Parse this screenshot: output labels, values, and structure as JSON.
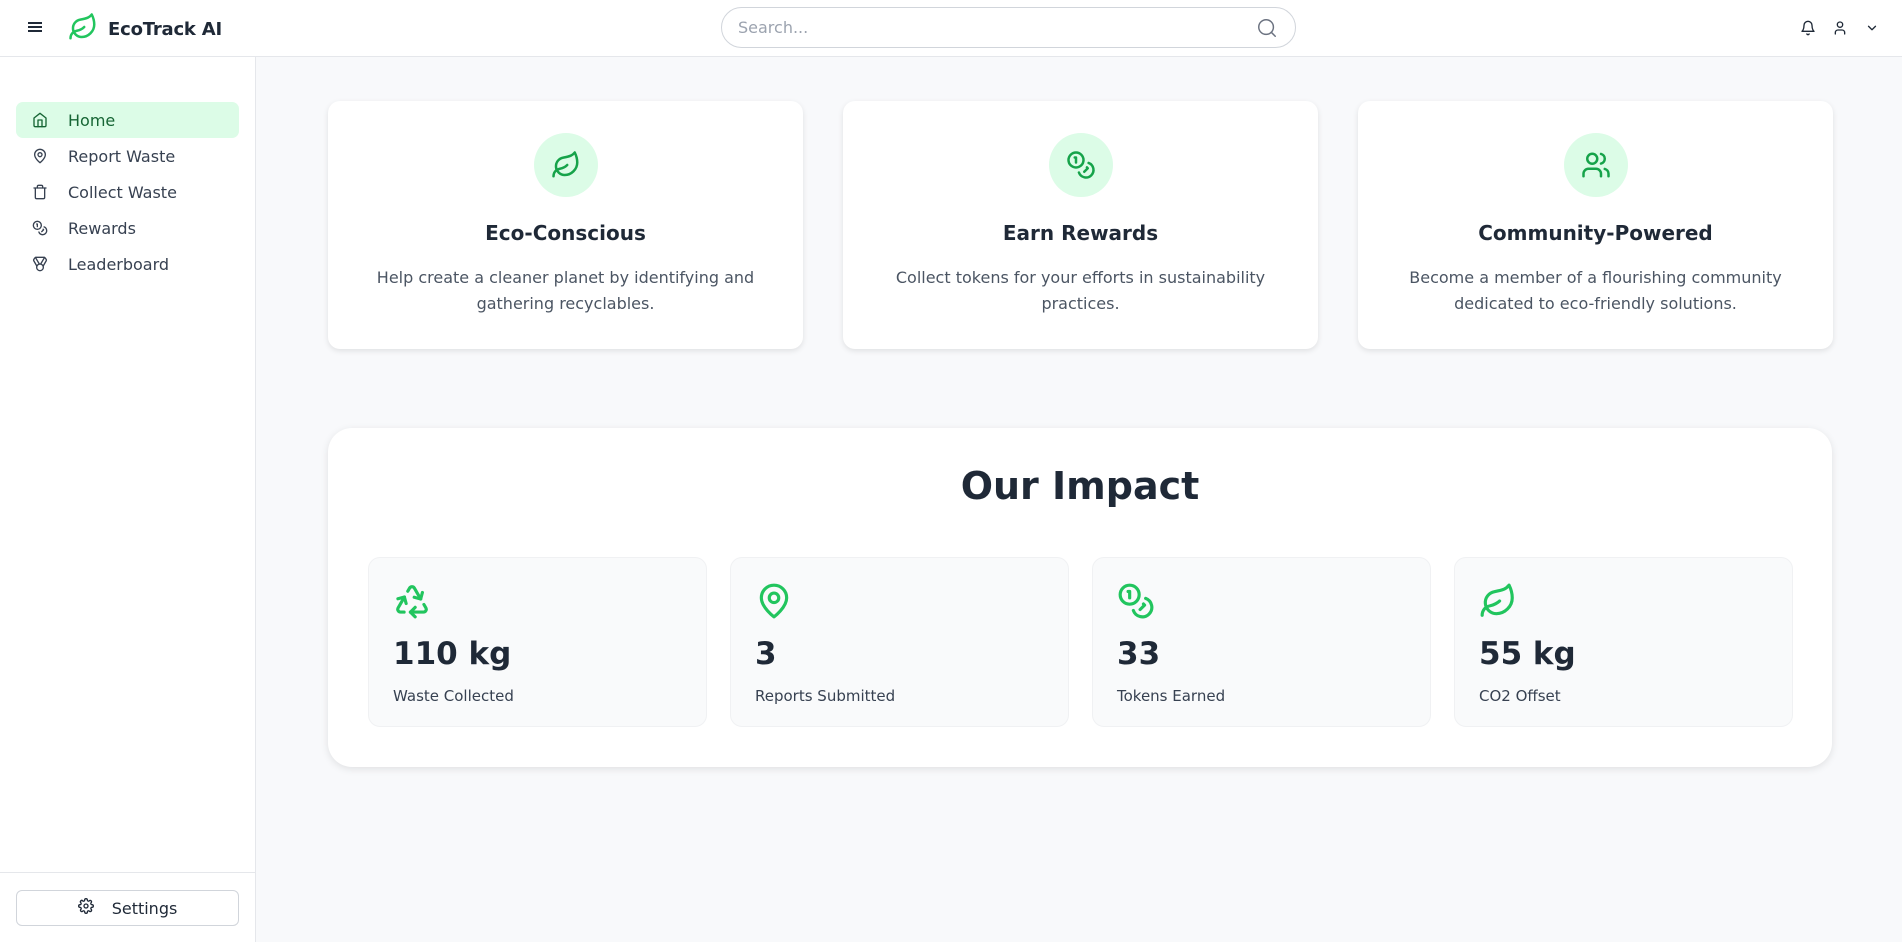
{
  "header": {
    "app_name": "EcoTrack AI",
    "search_placeholder": "Search...",
    "menu_icon": "menu-icon",
    "logo_icon": "leaf-icon",
    "search_icon": "search-icon",
    "notification_icon": "bell-icon",
    "user_icon": "user-icon",
    "dropdown_icon": "chevron-down-icon"
  },
  "sidebar": {
    "items": [
      {
        "label": "Home",
        "icon": "home-icon",
        "active": true
      },
      {
        "label": "Report Waste",
        "icon": "map-pin-icon",
        "active": false
      },
      {
        "label": "Collect Waste",
        "icon": "trash-icon",
        "active": false
      },
      {
        "label": "Rewards",
        "icon": "coins-icon",
        "active": false
      },
      {
        "label": "Leaderboard",
        "icon": "medal-icon",
        "active": false
      }
    ],
    "settings_label": "Settings",
    "settings_icon": "gear-icon"
  },
  "features": [
    {
      "title": "Eco-Conscious",
      "description": "Help create a cleaner planet by identifying and gathering recyclables.",
      "icon": "leaf-icon"
    },
    {
      "title": "Earn Rewards",
      "description": "Collect tokens for your efforts in sustainability practices.",
      "icon": "coins-icon"
    },
    {
      "title": "Community-Powered",
      "description": "Become a member of a flourishing community dedicated to eco-friendly solutions.",
      "icon": "users-icon"
    }
  ],
  "impact": {
    "title": "Our Impact",
    "stats": [
      {
        "value": "110 kg",
        "label": "Waste Collected",
        "icon": "recycle-icon"
      },
      {
        "value": "3",
        "label": "Reports Submitted",
        "icon": "map-pin-icon"
      },
      {
        "value": "33",
        "label": "Tokens Earned",
        "icon": "coins-icon"
      },
      {
        "value": "55 kg",
        "label": "CO2 Offset",
        "icon": "leaf-icon"
      }
    ]
  },
  "colors": {
    "accent": "#22c55e",
    "accent_dark": "#16a34a",
    "accent_light": "#dcfce7",
    "active_text": "#166534"
  }
}
